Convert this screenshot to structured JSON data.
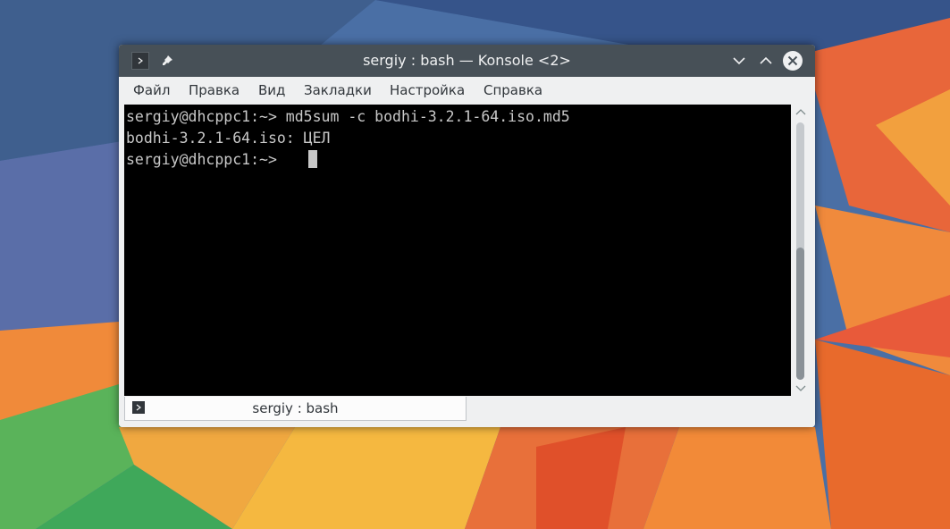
{
  "window": {
    "title": "sergiy : bash — Konsole <2>"
  },
  "menu": {
    "items": [
      "Файл",
      "Правка",
      "Вид",
      "Закладки",
      "Настройка",
      "Справка"
    ]
  },
  "terminal": {
    "lines": [
      "sergiy@dhcppc1:~> md5sum -c bodhi-3.2.1-64.iso.md5",
      "bodhi-3.2.1-64.iso: ЦЕЛ",
      "sergiy@dhcppc1:~> "
    ]
  },
  "tabs": [
    {
      "label": "sergiy : bash"
    }
  ],
  "colors": {
    "titlebar": "#475057",
    "window_bg": "#eff0f1",
    "terminal_bg": "#000000",
    "terminal_fg": "#c8c8c8",
    "close_button": "#eff0f1"
  },
  "icons": {
    "app": "terminal-icon",
    "pin": "pin-icon",
    "minimize": "chevron-down-icon",
    "maximize": "chevron-up-icon",
    "close": "close-icon"
  }
}
